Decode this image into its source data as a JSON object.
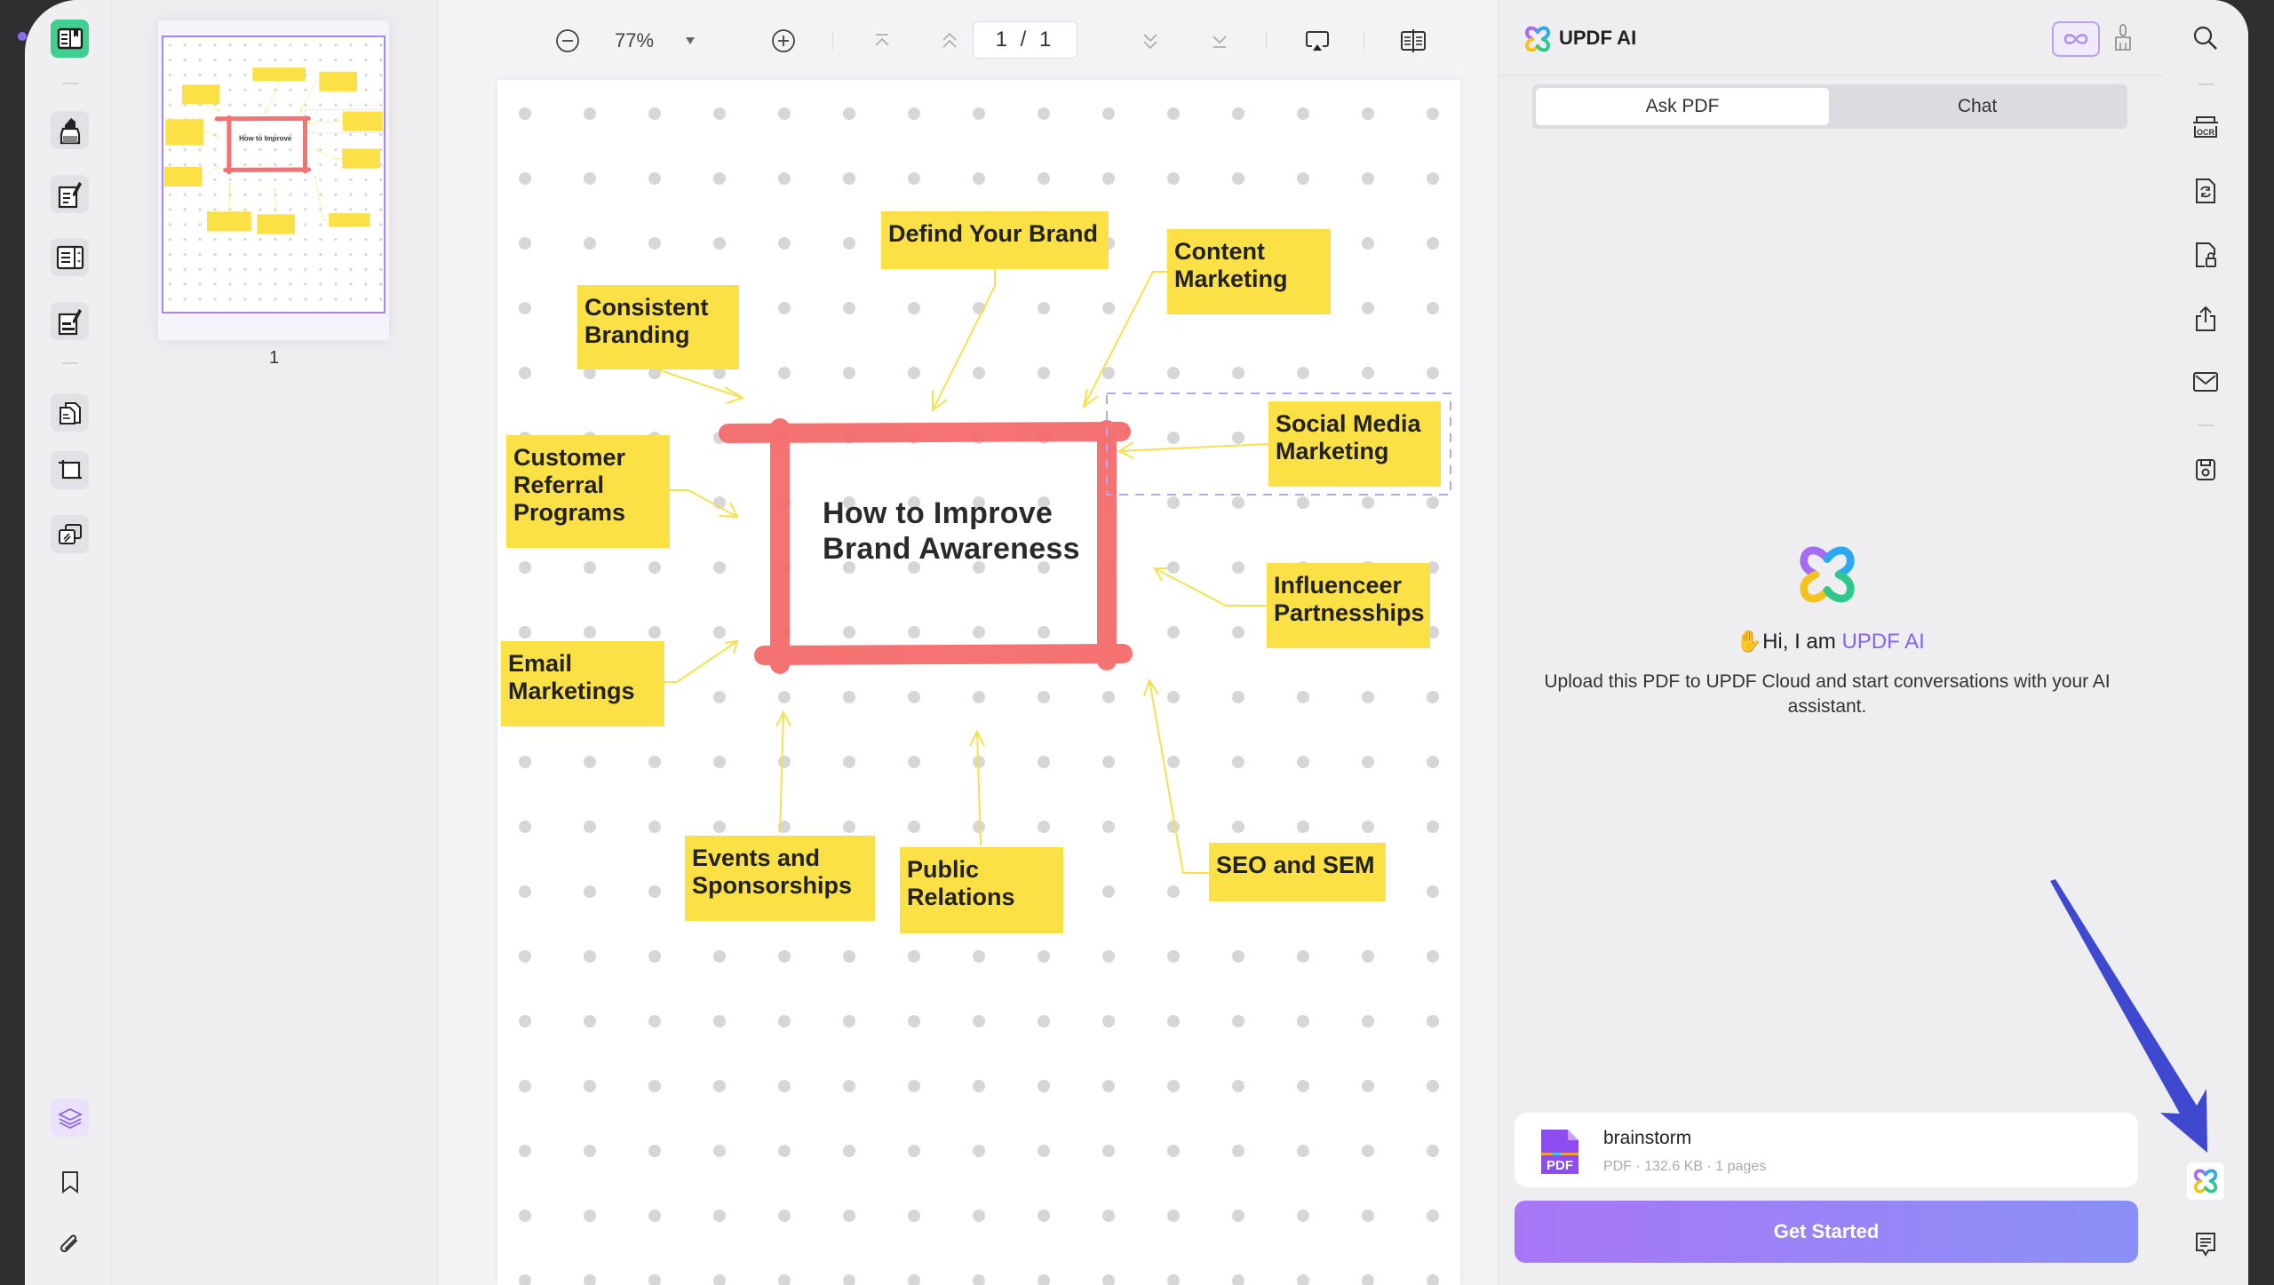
{
  "app": {
    "name": "UPDF"
  },
  "left_rail": {
    "tools": [
      {
        "id": "reader",
        "label": "Reader"
      },
      {
        "id": "comment",
        "label": "Comment"
      },
      {
        "id": "edit",
        "label": "Edit PDF"
      },
      {
        "id": "organize",
        "label": "Organize Pages"
      },
      {
        "id": "form",
        "label": "Prepare Form"
      },
      {
        "id": "convert",
        "label": "Page Tools"
      },
      {
        "id": "crop",
        "label": "Crop"
      },
      {
        "id": "compare",
        "label": "Compare"
      }
    ],
    "bottom": [
      {
        "id": "layers",
        "label": "Layers"
      },
      {
        "id": "bookmark",
        "label": "Bookmarks"
      },
      {
        "id": "attachment",
        "label": "Attachments"
      }
    ]
  },
  "thumbnails": {
    "pages": [
      {
        "number": "1"
      }
    ]
  },
  "toolbar": {
    "zoom_value": "77%",
    "page_current": "1",
    "page_total": "1",
    "page_display": "1 / 1"
  },
  "document": {
    "title": "How to Improve Brand Awareness",
    "title_lines": [
      "How to Improve",
      "Brand Awareness"
    ],
    "nodes": [
      {
        "id": "defind-your-brand",
        "lines": [
          "Defind Your Brand"
        ]
      },
      {
        "id": "content-marketing",
        "lines": [
          "Content",
          "Marketing"
        ]
      },
      {
        "id": "consistent-branding",
        "lines": [
          "Consistent",
          "Branding"
        ]
      },
      {
        "id": "social-media-marketing",
        "lines": [
          "Social Media",
          "Marketing"
        ]
      },
      {
        "id": "customer-referral-programs",
        "lines": [
          "Customer",
          "Referral",
          "Programs"
        ]
      },
      {
        "id": "influencer-partnerships",
        "lines": [
          "Influenceer",
          "Partnesships"
        ]
      },
      {
        "id": "email-marketings",
        "lines": [
          "Email",
          "Marketings"
        ]
      },
      {
        "id": "events-and-sponsorships",
        "lines": [
          "Events and",
          "Sponsorships"
        ]
      },
      {
        "id": "public-relations",
        "lines": [
          "Public",
          "Relations"
        ]
      },
      {
        "id": "seo-and-sem",
        "lines": [
          "SEO and SEM"
        ]
      }
    ]
  },
  "ai_panel": {
    "title": "UPDF AI",
    "tabs": [
      {
        "label": "Ask PDF",
        "active": true
      },
      {
        "label": "Chat",
        "active": false
      }
    ],
    "greeting_prefix": "Hi, I am ",
    "greeting_brand": "UPDF AI",
    "subtitle": "Upload this PDF to UPDF Cloud and start conversations with your AI assistant.",
    "file": {
      "name": "brainstorm",
      "meta": "PDF · 132.6 KB · 1 pages",
      "badge": "PDF"
    },
    "cta_label": "Get Started"
  },
  "right_rail": {
    "items": [
      {
        "id": "search",
        "label": "Search"
      },
      {
        "id": "ocr",
        "label": "OCR"
      },
      {
        "id": "convert",
        "label": "Convert"
      },
      {
        "id": "protect",
        "label": "Protect"
      },
      {
        "id": "share",
        "label": "Share"
      },
      {
        "id": "email",
        "label": "Email"
      },
      {
        "id": "save",
        "label": "Save"
      },
      {
        "id": "ai",
        "label": "UPDF AI"
      },
      {
        "id": "comments",
        "label": "Comments"
      }
    ]
  },
  "colors": {
    "accent_purple": "#8464f0",
    "sticky_yellow": "#fbe046",
    "marker_red": "#f46b6b",
    "reader_green": "#3fcf8e",
    "annotation_arrow": "#3f49d0",
    "cta_gradient_start": "#a877f7",
    "cta_gradient_end": "#8a8ff7"
  }
}
